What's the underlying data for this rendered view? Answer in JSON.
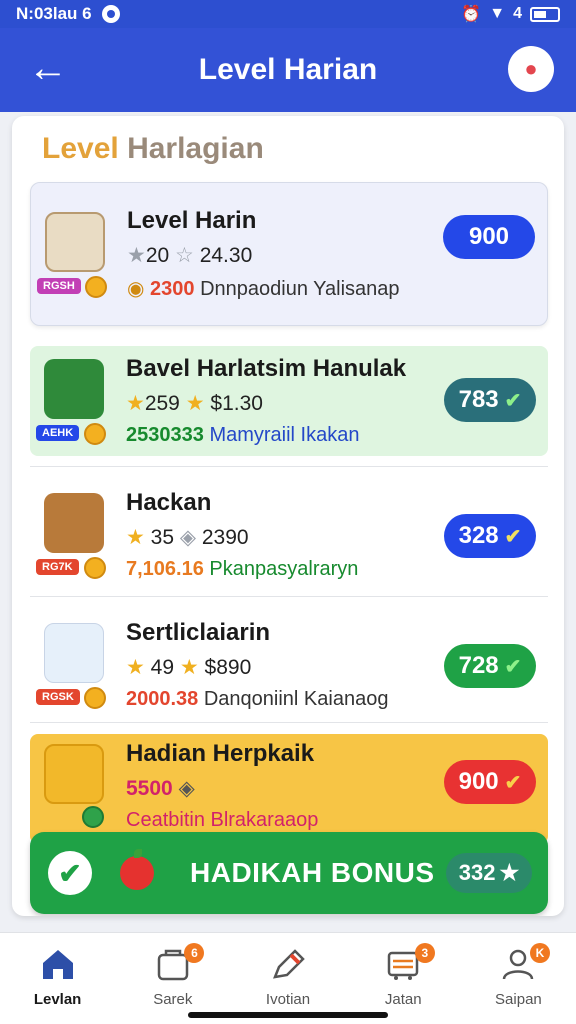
{
  "status_bar": {
    "time": "N:03lau 6",
    "signal_text": "4"
  },
  "header": {
    "title": "Level Harian",
    "back_icon": "arrow-left-icon",
    "chat_icon": "chat-bubble-icon"
  },
  "section_title": {
    "part1": "Level ",
    "part2": "Harlagian"
  },
  "rows": [
    {
      "name": "Level Harin",
      "stat1": "20",
      "stat2": "24.30",
      "sub_value": "2300",
      "sub_text": "Dnnpaodiun Yalisanap",
      "tag": "RGSH",
      "points": "900",
      "pill_color": "#2448e8",
      "row_bg": "#eef0fb",
      "sub_color": "#e3462e",
      "checked": false
    },
    {
      "name": "Bavel Harlatsim Hanulak",
      "stat1": "259",
      "stat2": "$1.30",
      "sub_value": "2530333",
      "sub_text": "Mamyraiil Ikakan",
      "tag": "AEHK",
      "points": "783",
      "pill_color": "#2a6f7a",
      "row_bg": "#dff5e0",
      "sub_color": "#178a2e",
      "checked": true
    },
    {
      "name": "Hackan",
      "stat1": "35",
      "stat2": "2390",
      "sub_value": "7,106.16",
      "sub_text": "Pkanpasyalraryn",
      "tag": "RG7K",
      "points": "328",
      "pill_color": "#2448e8",
      "row_bg": "#ffffff",
      "sub_color": "#e87a20",
      "checked": true
    },
    {
      "name": "Sertliclaiarin",
      "stat1": "49",
      "stat2": "$890",
      "sub_value": "2000.38",
      "sub_text": "Danqoniinl Kaianaog",
      "tag": "RGSK",
      "points": "728",
      "pill_color": "#1fa246",
      "row_bg": "#ffffff",
      "sub_color": "#e3462e",
      "checked": true
    },
    {
      "name": "Hadian Herpkaik",
      "stat1": "5500",
      "stat2": "",
      "sub_value": "",
      "sub_text": "Ceatbitin Blrakaraaop",
      "tag": "",
      "points": "900",
      "pill_color": "#e83232",
      "row_bg": "#f7c545",
      "sub_color": "#d2226a",
      "checked": true
    }
  ],
  "bonus": {
    "label": "HADIKAH BONUS",
    "count": "332"
  },
  "nav": [
    {
      "label": "Levlan",
      "icon": "home-icon",
      "badge": ""
    },
    {
      "label": "Sarek",
      "icon": "bag-icon",
      "badge": "6"
    },
    {
      "label": "Ivotian",
      "icon": "pen-icon",
      "badge": ""
    },
    {
      "label": "Jatan",
      "icon": "cart-icon",
      "badge": "3"
    },
    {
      "label": "Saipan",
      "icon": "user-icon",
      "badge": "K"
    }
  ]
}
